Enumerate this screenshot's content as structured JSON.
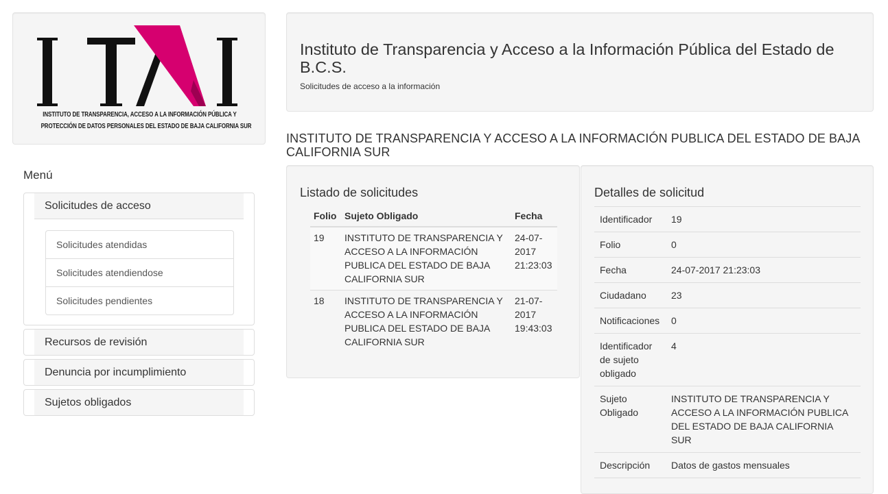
{
  "logo": {
    "letters": "ITAI",
    "subtitle_line1": "INSTITUTO DE TRANSPARENCIA, ACCESO A LA INFORMACIÓN PÚBLICA Y",
    "subtitle_line2": "PROTECCIÓN DE DATOS PERSONALES DEL ESTADO DE BAJA CALIFORNIA SUR",
    "accent_color": "#d6006f"
  },
  "menu": {
    "title": "Menú",
    "sections": [
      {
        "label": "Solicitudes de acceso",
        "items": [
          {
            "label": "Solicitudes atendidas"
          },
          {
            "label": "Solicitudes atendiendose"
          },
          {
            "label": "Solicitudes pendientes"
          }
        ]
      },
      {
        "label": "Recursos de revisión"
      },
      {
        "label": "Denuncia por incumplimiento"
      },
      {
        "label": "Sujetos obligados"
      }
    ]
  },
  "header": {
    "title": "Instituto de Transparencia y Acceso a la Información Pública del Estado de B.C.S.",
    "subtitle": "Solicitudes de acceso a la información"
  },
  "entity_title": "INSTITUTO DE TRANSPARENCIA Y ACCESO A LA INFORMACIÓN PUBLICA DEL ESTADO DE BAJA CALIFORNIA SUR",
  "listado": {
    "title": "Listado de solicitudes",
    "columns": [
      "Folio",
      "Sujeto Obligado",
      "Fecha"
    ],
    "rows": [
      {
        "folio": "19",
        "sujeto": "INSTITUTO DE TRANSPARENCIA Y ACCESO A LA INFORMACIÓN PUBLICA DEL ESTADO DE BAJA CALIFORNIA SUR",
        "fecha": "24-07-2017 21:23:03"
      },
      {
        "folio": "18",
        "sujeto": "INSTITUTO DE TRANSPARENCIA Y ACCESO A LA INFORMACIÓN PUBLICA DEL ESTADO DE BAJA CALIFORNIA SUR",
        "fecha": "21-07-2017 19:43:03"
      }
    ]
  },
  "detalles": {
    "title": "Detalles de solicitud",
    "rows": [
      {
        "key": "Identificador",
        "value": "19"
      },
      {
        "key": "Folio",
        "value": "0"
      },
      {
        "key": "Fecha",
        "value": "24-07-2017 21:23:03"
      },
      {
        "key": "Ciudadano",
        "value": "23"
      },
      {
        "key": "Notificaciones",
        "value": "0"
      },
      {
        "key": "Identificador de sujeto obligado",
        "value": "4"
      },
      {
        "key": "Sujeto Obligado",
        "value": "INSTITUTO DE TRANSPARENCIA Y ACCESO A LA INFORMACIÓN PUBLICA DEL ESTADO DE BAJA CALIFORNIA SUR"
      },
      {
        "key": "Descripción",
        "value": "Datos de gastos mensuales"
      }
    ]
  }
}
